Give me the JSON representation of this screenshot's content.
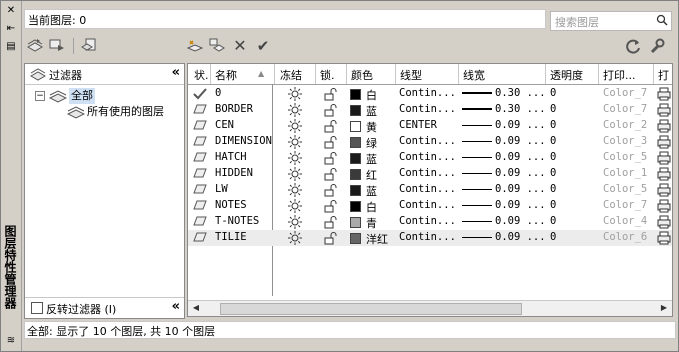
{
  "palette_title": "图层特性管理器",
  "current_layer": "当前图层: 0",
  "search_placeholder": "搜索图层",
  "filter_panel": {
    "title": "过滤器",
    "tree": [
      {
        "label": "全部"
      },
      {
        "label": "所有使用的图层"
      }
    ],
    "invert_label": "反转过滤器 (I)"
  },
  "columns": [
    "状.",
    "名称",
    "冻结",
    "锁.",
    "颜色",
    "线型",
    "线宽",
    "透明度",
    "打印...",
    "打"
  ],
  "layers": [
    {
      "name": "0",
      "color": "白",
      "swatch": "#000000",
      "linetype": "Contin...",
      "lineweight": "0.30 ...",
      "transparency": "0",
      "plot_style": "Color_7",
      "current": true
    },
    {
      "name": "BORDER",
      "color": "蓝",
      "swatch": "#1a1a1a",
      "linetype": "Contin...",
      "lineweight": "0.30 ...",
      "transparency": "0",
      "plot_style": "Color_7"
    },
    {
      "name": "CEN",
      "color": "黄",
      "swatch": "#ffffff",
      "linetype": "CENTER",
      "lineweight": "0.09 ...",
      "transparency": "0",
      "plot_style": "Color_2"
    },
    {
      "name": "DIMENSION",
      "color": "绿",
      "swatch": "#555555",
      "linetype": "Contin...",
      "lineweight": "0.09 ...",
      "transparency": "0",
      "plot_style": "Color_3"
    },
    {
      "name": "HATCH",
      "color": "蓝",
      "swatch": "#1a1a1a",
      "linetype": "Contin...",
      "lineweight": "0.09 ...",
      "transparency": "0",
      "plot_style": "Color_5"
    },
    {
      "name": "HIDDEN",
      "color": "红",
      "swatch": "#3a3a3a",
      "linetype": "Contin...",
      "lineweight": "0.09 ...",
      "transparency": "0",
      "plot_style": "Color_1"
    },
    {
      "name": "LW",
      "color": "蓝",
      "swatch": "#1a1a1a",
      "linetype": "Contin...",
      "lineweight": "0.09 ...",
      "transparency": "0",
      "plot_style": "Color_5"
    },
    {
      "name": "NOTES",
      "color": "白",
      "swatch": "#000000",
      "linetype": "Contin...",
      "lineweight": "0.09 ...",
      "transparency": "0",
      "plot_style": "Color_7"
    },
    {
      "name": "T-NOTES",
      "color": "青",
      "swatch": "#aaaaaa",
      "linetype": "Contin...",
      "lineweight": "0.09 ...",
      "transparency": "0",
      "plot_style": "Color_4"
    },
    {
      "name": "TILIE",
      "color": "洋红",
      "swatch": "#666666",
      "linetype": "Contin...",
      "lineweight": "0.09 ...",
      "transparency": "0",
      "plot_style": "Color_6"
    }
  ],
  "status_text": "全部: 显示了 10 个图层, 共 10 个图层"
}
